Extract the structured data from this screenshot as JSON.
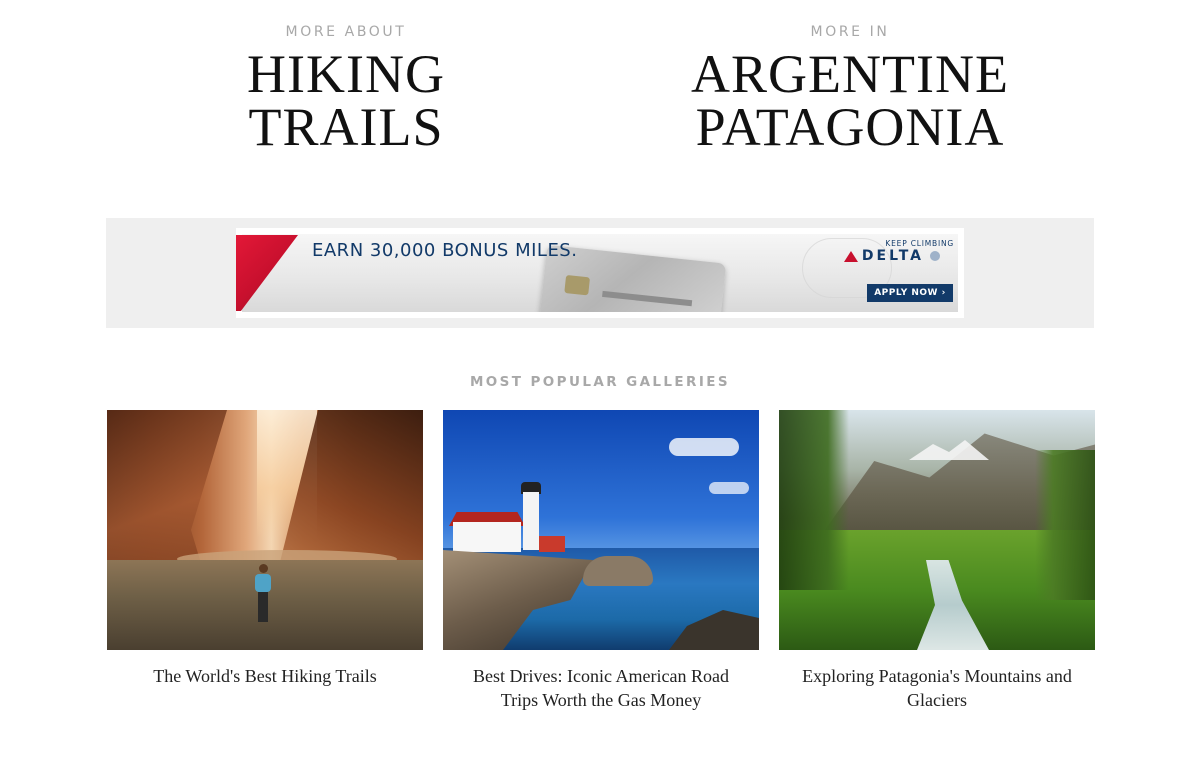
{
  "topics": [
    {
      "kicker": "MORE ABOUT",
      "title_line1": "HIKING",
      "title_line2": "TRAILS"
    },
    {
      "kicker": "MORE IN",
      "title_line1": "ARGENTINE",
      "title_line2": "PATAGONIA"
    }
  ],
  "ad": {
    "headline": "EARN 30,000 BONUS MILES.",
    "tagline": "KEEP CLIMBING",
    "brand": "DELTA",
    "cta": "APPLY NOW ›",
    "icons": {
      "brand_mark": "delta-widget-icon",
      "card": "credit-card-image"
    },
    "colors": {
      "brand_red": "#c8102e",
      "brand_navy": "#123a69"
    }
  },
  "popular": {
    "heading": "MOST POPULAR GALLERIES",
    "cards": [
      {
        "title": "The World's Best Hiking Trails",
        "image": "canyon-hiker-photo"
      },
      {
        "title": "Best Drives: Iconic American Road Trips Worth the Gas Money",
        "image": "lighthouse-coast-photo"
      },
      {
        "title": "Exploring Patagonia's Mountains and Glaciers",
        "image": "patagonia-valley-photo"
      }
    ]
  }
}
